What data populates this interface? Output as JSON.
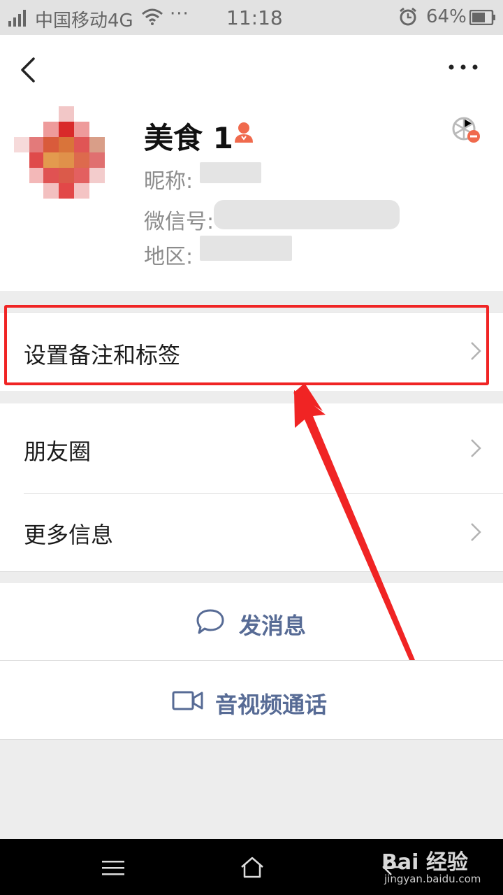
{
  "status_bar": {
    "carrier": "中国移动4G",
    "dots": "···",
    "time": "11:18",
    "battery": "64%"
  },
  "contact": {
    "name": "美食 1",
    "nickname_label": "昵称:",
    "wechat_id_label": "微信号:",
    "region_label": "地区:"
  },
  "menu": {
    "remark": "设置备注和标签",
    "moments": "朋友圈",
    "more_info": "更多信息"
  },
  "actions": {
    "message": "发消息",
    "call": "音视频通话"
  },
  "watermark": {
    "brand": "Bai 经验",
    "url": "jingyan.baidu.com"
  },
  "colors": {
    "link": "#576b95",
    "highlight": "#f02424",
    "gender_icon": "#f06a4d"
  },
  "icons": {
    "back": "chevron-left-icon",
    "more": "more-dots-icon",
    "gender": "female-icon",
    "star": "star-friend-icon",
    "message": "chat-bubble-icon",
    "call": "video-camera-icon"
  }
}
